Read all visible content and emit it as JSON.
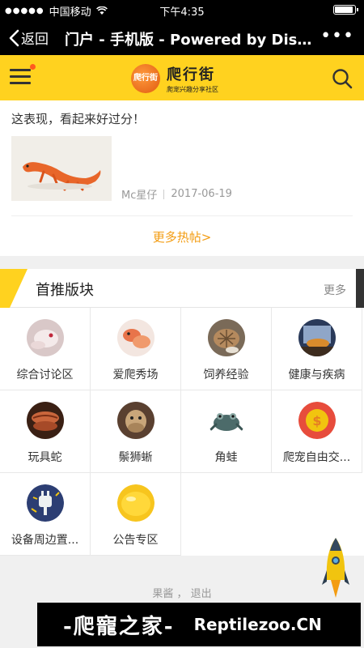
{
  "status_bar": {
    "carrier": "中国移动",
    "time": "下午4:35"
  },
  "browser_nav": {
    "back_label": "返回",
    "title": "门户 - 手机版 - Powered by Disc...",
    "more": "•••"
  },
  "site": {
    "logo_text": "爬行街",
    "logo_mark": "爬行街",
    "logo_sub": "爬宠兴趣分享社区",
    "accent_color": "#ffd21f"
  },
  "hot_post": {
    "title": "这表现，看起来好过分！",
    "author": "Mc星仔",
    "date": "2017-06-19",
    "more_label": "更多热帖>"
  },
  "section": {
    "title": "首推版块",
    "more_label": "更多",
    "forums": [
      {
        "label": "综合讨论区",
        "icon": "albino-snake-icon"
      },
      {
        "label": "爱爬秀场",
        "icon": "gecko-icon"
      },
      {
        "label": "饲养经验",
        "icon": "tortoise-icon"
      },
      {
        "label": "健康与疾病",
        "icon": "lizard-enclosure-icon"
      },
      {
        "label": "玩具蛇",
        "icon": "snake-coil-icon"
      },
      {
        "label": "鬃狮蜥",
        "icon": "bearded-dragon-icon"
      },
      {
        "label": "角蛙",
        "icon": "horned-frog-icon"
      },
      {
        "label": "爬宠自由交...",
        "icon": "coin-icon"
      },
      {
        "label": "设备周边置...",
        "icon": "plug-icon"
      },
      {
        "label": "公告专区",
        "icon": "lemon-icon"
      }
    ]
  },
  "footer": {
    "user": "果酱",
    "separator": "，",
    "logout": "退出"
  },
  "watermark": {
    "cn": "-爬寵之家-",
    "en": "Reptilezoo.CN"
  }
}
